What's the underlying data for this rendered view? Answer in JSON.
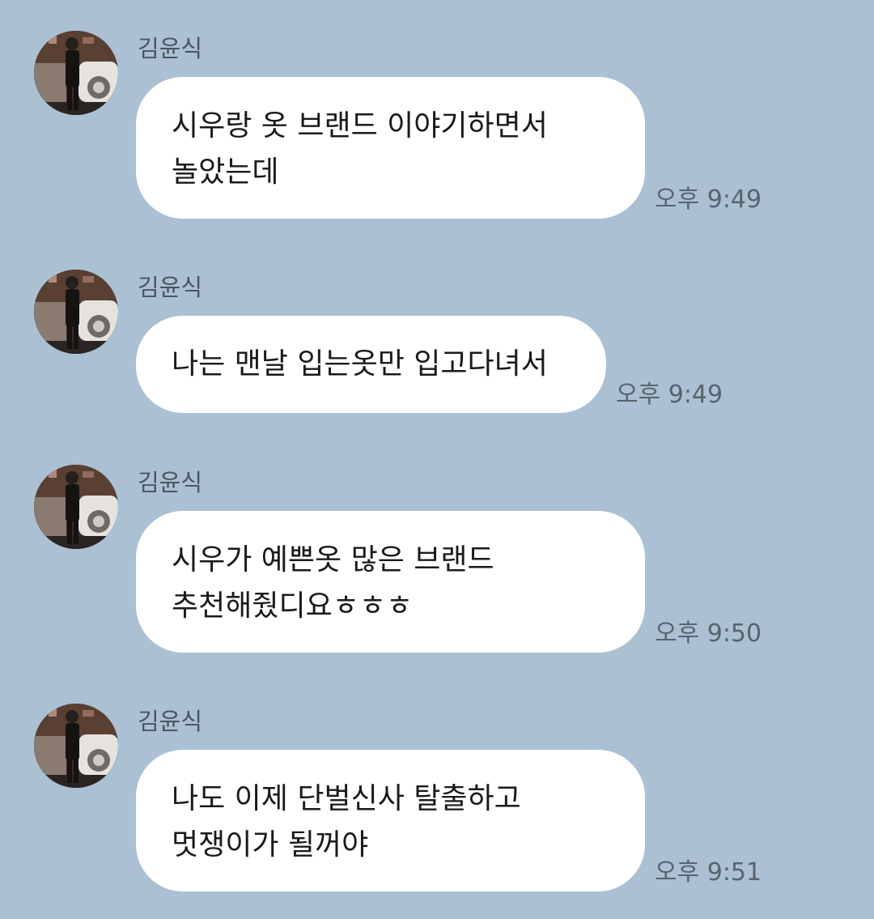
{
  "messages": [
    {
      "sender": "김윤식",
      "lines": [
        "시우랑 옷 브랜드 이야기하면서",
        "놀았는데"
      ],
      "time": "오후 9:49"
    },
    {
      "sender": "김윤식",
      "lines": [
        "나는 맨날 입는옷만 입고다녀서"
      ],
      "time": "오후 9:49"
    },
    {
      "sender": "김윤식",
      "lines": [
        "시우가 예쁜옷 많은 브랜드",
        "추천해줬디요ㅎㅎㅎ"
      ],
      "time": "오후 9:50"
    },
    {
      "sender": "김윤식",
      "lines": [
        "나도 이제 단벌신사 탈출하고",
        "멋쟁이가 될꺼야"
      ],
      "time": "오후 9:51"
    }
  ],
  "colors": {
    "background": "#abc1d3",
    "bubble": "#ffffff",
    "sender_text": "#4b5560",
    "time_text": "#58636e"
  },
  "icons": {
    "avatar": "profile-photo"
  }
}
